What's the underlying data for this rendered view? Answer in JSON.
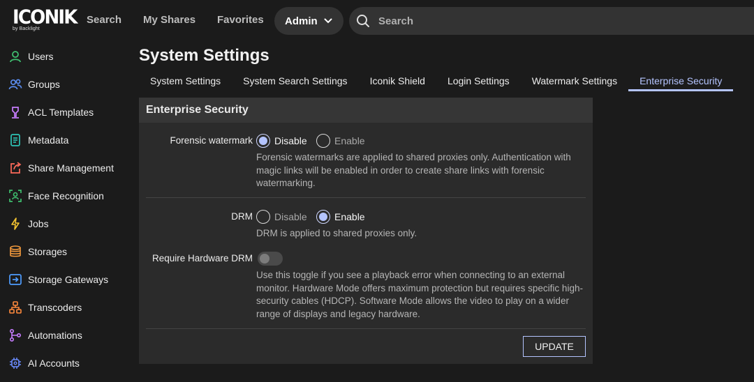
{
  "logo": {
    "word": "ICONIK",
    "sub": "by Backlight"
  },
  "nav": {
    "search": "Search",
    "my_shares": "My Shares",
    "favorites": "Favorites",
    "admin": "Admin"
  },
  "search": {
    "placeholder": "Search"
  },
  "sidebar": {
    "items": [
      {
        "label": "Users",
        "icon": "user-icon",
        "color": "#3fbf6f"
      },
      {
        "label": "Groups",
        "icon": "group-icon",
        "color": "#5b8def"
      },
      {
        "label": "ACL Templates",
        "icon": "lock-template-icon",
        "color": "#c77dff"
      },
      {
        "label": "Metadata",
        "icon": "document-icon",
        "color": "#2ec4b6"
      },
      {
        "label": "Share Management",
        "icon": "share-icon",
        "color": "#ff6b5b"
      },
      {
        "label": "Face Recognition",
        "icon": "face-scan-icon",
        "color": "#3fbf6f"
      },
      {
        "label": "Jobs",
        "icon": "lightning-icon",
        "color": "#f4c430"
      },
      {
        "label": "Storages",
        "icon": "database-icon",
        "color": "#f59b3d"
      },
      {
        "label": "Storage Gateways",
        "icon": "gateway-icon",
        "color": "#4f9dff"
      },
      {
        "label": "Transcoders",
        "icon": "transcoder-icon",
        "color": "#ff8a3d"
      },
      {
        "label": "Automations",
        "icon": "automation-icon",
        "color": "#c77dff"
      },
      {
        "label": "AI Accounts",
        "icon": "ai-icon",
        "color": "#6b8cff"
      }
    ]
  },
  "page": {
    "title": "System Settings"
  },
  "tabs": [
    {
      "label": "System Settings"
    },
    {
      "label": "System Search Settings"
    },
    {
      "label": "Iconik Shield"
    },
    {
      "label": "Login Settings"
    },
    {
      "label": "Watermark Settings"
    },
    {
      "label": "Enterprise Security",
      "active": true
    }
  ],
  "panel": {
    "title": "Enterprise Security",
    "forensic": {
      "label": "Forensic watermark",
      "disable": "Disable",
      "enable": "Enable",
      "selected": "Disable",
      "help": "Forensic watermarks are applied to shared proxies only. Authentication with magic links will be enabled in order to create share links with forensic watermarking."
    },
    "drm": {
      "label": "DRM",
      "disable": "Disable",
      "enable": "Enable",
      "selected": "Enable",
      "help": "DRM is applied to shared proxies only."
    },
    "hardware_drm": {
      "label": "Require Hardware DRM",
      "enabled": false,
      "help": "Use this toggle if you see a playback error when connecting to an external monitor. Hardware Mode offers maximum protection but requires specific high-security cables (HDCP). Software Mode allows the video to play on a wider range of displays and legacy hardware."
    },
    "update_label": "UPDATE"
  },
  "colors": {
    "accent": "#b4c4ff",
    "background": "#1b1b1b",
    "panel": "#2b2b2b"
  }
}
